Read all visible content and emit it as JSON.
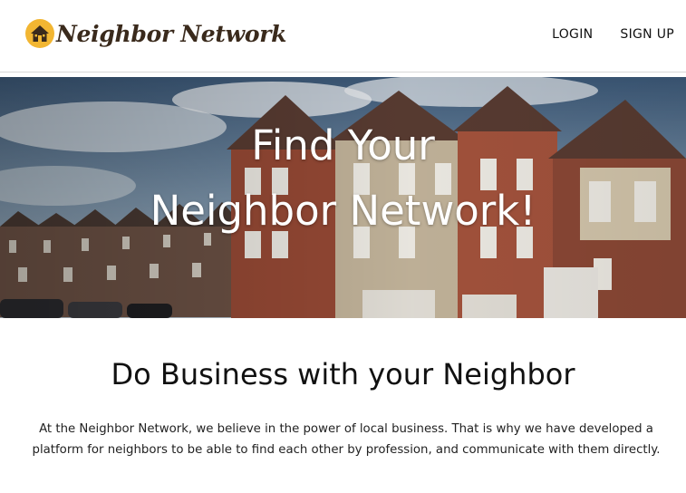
{
  "brand": {
    "name": "Neighbor Network",
    "logo_icon": "house-icon"
  },
  "nav": {
    "login_label": "LOGIN",
    "signup_label": "SIGN UP"
  },
  "hero": {
    "title_line1": "Find Your",
    "title_line2": "Neighbor Network!"
  },
  "about": {
    "heading": "Do Business with your Neighbor",
    "body": "At the Neighbor Network, we believe in the power of local business. That is why we have developed a platform for neighbors to be able to find each other by profession, and communicate with them directly."
  },
  "colors": {
    "logo_circle": "#f2b632",
    "logo_house": "#3a2a1c",
    "brand_text": "#3a2a1c",
    "nav_text": "#111111"
  }
}
